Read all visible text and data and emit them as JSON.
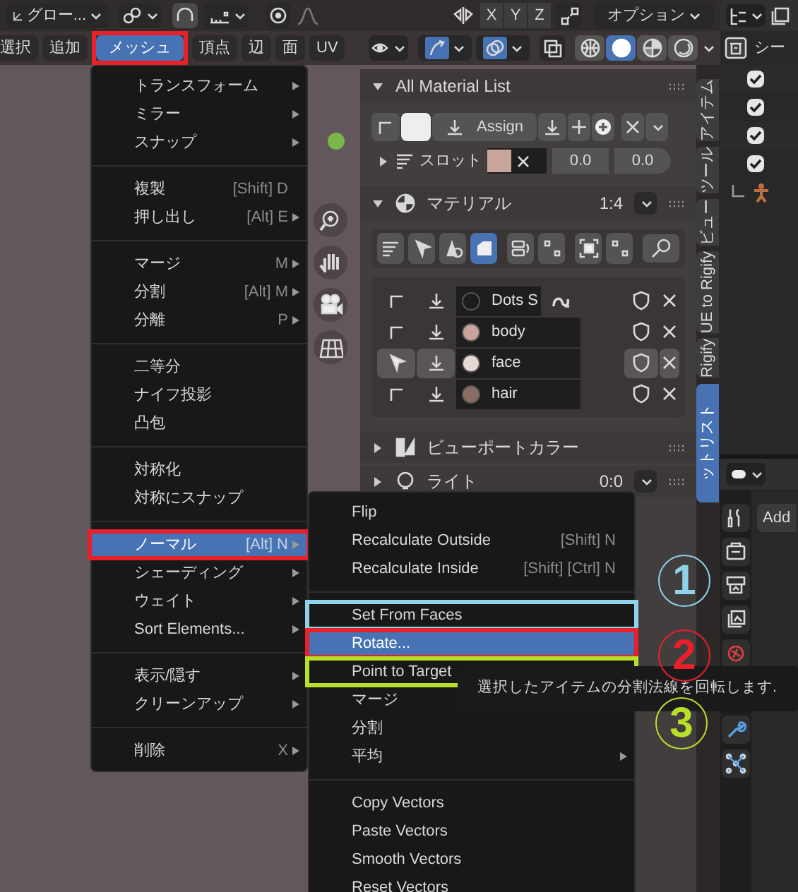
{
  "header": {
    "orientation": "グロー...",
    "axes": [
      "X",
      "Y",
      "Z"
    ],
    "options": "オプション"
  },
  "menubar": [
    {
      "label": "選択",
      "selected": false
    },
    {
      "label": "追加",
      "selected": false
    },
    {
      "label": "メッシュ",
      "selected": true,
      "color": "#e8202a"
    },
    {
      "label": "頂点",
      "selected": false
    },
    {
      "label": "辺",
      "selected": false
    },
    {
      "label": "面",
      "selected": false
    },
    {
      "label": "UV",
      "selected": false
    }
  ],
  "shading": [
    {
      "kind": "wireframe",
      "selected": false
    },
    {
      "kind": "solid",
      "selected": true
    },
    {
      "kind": "material",
      "selected": false
    },
    {
      "kind": "rendered",
      "selected": false
    }
  ],
  "mesh_menu": [
    [
      {
        "label": "トランスフォーム",
        "submenu": true,
        "selected": false
      },
      {
        "label": "ミラー",
        "submenu": true,
        "selected": false
      },
      {
        "label": "スナップ",
        "submenu": true,
        "selected": false
      }
    ],
    [
      {
        "label": "複製",
        "shortcut": "[Shift] D",
        "submenu": false,
        "selected": false
      },
      {
        "label": "押し出し",
        "shortcut": "[Alt] E",
        "submenu": true,
        "selected": false
      }
    ],
    [
      {
        "label": "マージ",
        "shortcut": "M",
        "submenu": true,
        "selected": false
      },
      {
        "label": "分割",
        "shortcut": "[Alt] M",
        "submenu": true,
        "selected": false
      },
      {
        "label": "分離",
        "shortcut": "P",
        "submenu": true,
        "selected": false
      }
    ],
    [
      {
        "label": "二等分",
        "submenu": false,
        "selected": false
      },
      {
        "label": "ナイフ投影",
        "submenu": false,
        "selected": false
      },
      {
        "label": "凸包",
        "submenu": false,
        "selected": false
      }
    ],
    [
      {
        "label": "対称化",
        "submenu": false,
        "selected": false
      },
      {
        "label": "対称にスナップ",
        "submenu": false,
        "selected": false
      }
    ],
    [
      {
        "label": "ノーマル",
        "shortcut": "[Alt] N",
        "submenu": true,
        "selected": true,
        "color": "#e8202a"
      },
      {
        "label": "シェーディング",
        "submenu": true,
        "selected": false
      },
      {
        "label": "ウェイト",
        "submenu": true,
        "selected": false
      },
      {
        "label": "Sort Elements...",
        "submenu": true,
        "selected": false
      }
    ],
    [
      {
        "label": "表示/隠す",
        "submenu": true,
        "selected": false
      },
      {
        "label": "クリーンアップ",
        "submenu": true,
        "selected": false
      }
    ],
    [
      {
        "label": "削除",
        "shortcut": "X",
        "submenu": true,
        "selected": false
      }
    ]
  ],
  "normal_submenu": [
    [
      {
        "label": "Flip",
        "submenu": false,
        "selected": false
      },
      {
        "label": "Recalculate Outside",
        "shortcut": "[Shift] N",
        "submenu": false,
        "selected": false
      },
      {
        "label": "Recalculate Inside",
        "shortcut": "[Shift] [Ctrl] N",
        "submenu": false,
        "selected": false
      }
    ],
    [
      {
        "label": "Set From Faces",
        "submenu": false,
        "selected": false,
        "color": "#8fd3ea"
      },
      {
        "label": "Rotate...",
        "submenu": false,
        "selected": true,
        "color": "#e8202a"
      },
      {
        "label": "Point to Target",
        "submenu": false,
        "selected": false,
        "color": "#b8e02a"
      },
      {
        "label": "マージ",
        "submenu": false,
        "selected": false
      },
      {
        "label": "分割",
        "submenu": false,
        "selected": false
      },
      {
        "label": "平均",
        "submenu": true,
        "selected": false
      }
    ],
    [
      {
        "label": "Copy Vectors",
        "submenu": false,
        "selected": false
      },
      {
        "label": "Paste Vectors",
        "submenu": false,
        "selected": false
      },
      {
        "label": "Smooth Vectors",
        "submenu": false,
        "selected": false
      },
      {
        "label": "Reset Vectors",
        "submenu": false,
        "selected": false
      }
    ]
  ],
  "tooltip": "選択したアイテムの分割法線を回転します.",
  "markers": [
    {
      "label": "1",
      "color": "#8fd3ea"
    },
    {
      "label": "2",
      "color": "#e8202a"
    },
    {
      "label": "3",
      "color": "#b8e02a"
    }
  ],
  "material_list_panel": {
    "title": "All Material List",
    "expanded": true,
    "assign": "Assign",
    "slot_label": "スロット",
    "slot_expanded": false,
    "values": [
      "0.0",
      "0.0"
    ]
  },
  "material_panel": {
    "title": "マテリアル",
    "count": "1:4",
    "expanded": true,
    "materials": [
      {
        "name": "Dots S",
        "selected": false,
        "color": "#1c1c1c"
      },
      {
        "name": "body",
        "selected": false,
        "color": "#c9a49a"
      },
      {
        "name": "face",
        "selected": true,
        "color": "#e6d8d4"
      },
      {
        "name": "hair",
        "selected": false,
        "color": "#8a6c64"
      }
    ]
  },
  "collapsed_panels": [
    {
      "title": "ビューポートカラー",
      "expanded": false
    },
    {
      "title": "ライト",
      "count": "0:0",
      "expanded": false
    }
  ],
  "sidebar_tabs": [
    {
      "label": "アイテム",
      "selected": false
    },
    {
      "label": "ツール",
      "selected": false
    },
    {
      "label": "ビュー",
      "selected": false
    },
    {
      "label": "UE to Rigify",
      "selected": false
    },
    {
      "label": "Rigify",
      "selected": false
    },
    {
      "label": "ットリスト",
      "selected": true
    }
  ],
  "outliner": {
    "root": "シー",
    "rows": [
      {
        "checked": true
      },
      {
        "checked": true
      },
      {
        "checked": true
      },
      {
        "checked": true
      }
    ]
  },
  "properties": {
    "field": "Add"
  }
}
